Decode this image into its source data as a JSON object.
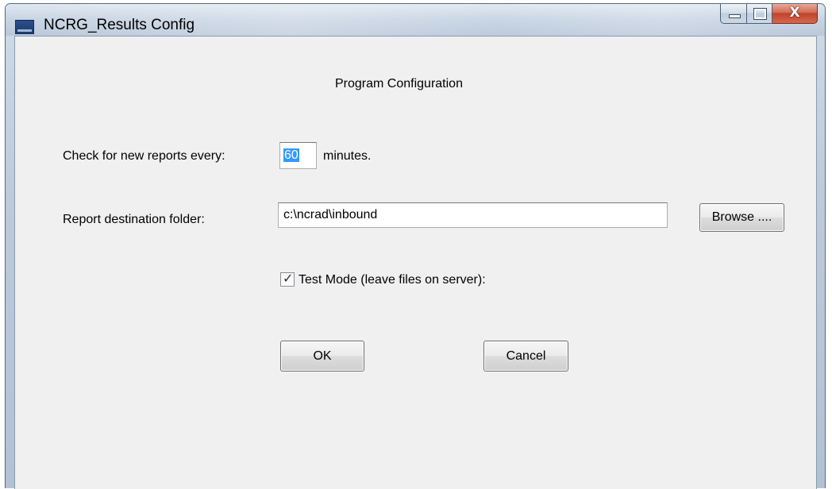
{
  "window": {
    "title": "NCRG_Results Config",
    "icons": {
      "app": "app-icon",
      "minimize": "minimize-icon",
      "maximize": "maximize-icon",
      "close": "close-icon"
    },
    "close_glyph": "X"
  },
  "form": {
    "heading": "Program Configuration",
    "check_label": "Check for new reports every:",
    "check_value": "60",
    "minutes_label": "minutes.",
    "folder_label": "Report destination folder:",
    "folder_value": "c:\\ncrad\\inbound",
    "browse_label": "Browse ....",
    "test_mode_label": "Test Mode (leave files on server):",
    "test_mode_checked": true,
    "ok_label": "OK",
    "cancel_label": "Cancel"
  },
  "colors": {
    "selection": "#3399ff",
    "client_background": "#f0f0f0",
    "close_button": "#c0432a"
  }
}
